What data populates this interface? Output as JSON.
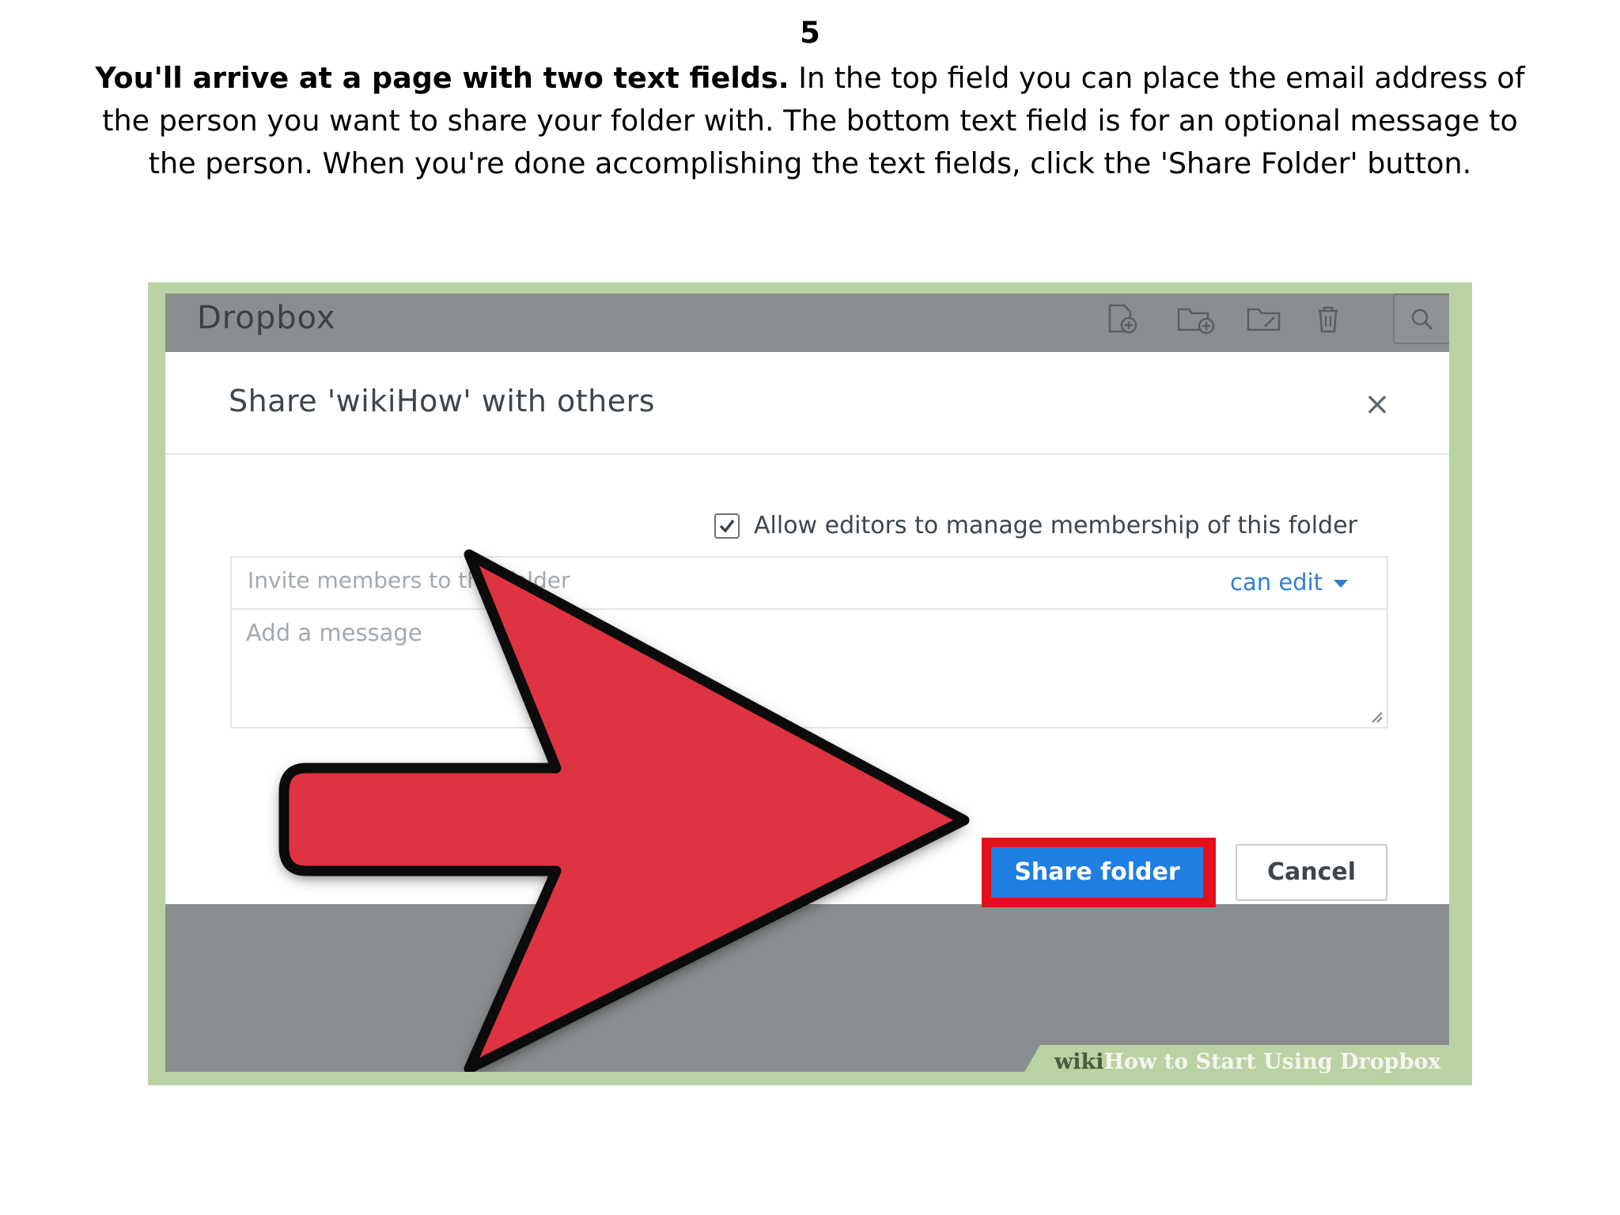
{
  "step": {
    "number": "5",
    "lead": "You'll arrive at a page with two text fields.",
    "body": " In the top field you can place the email address of the person you want to share your folder with. The bottom text field is for an optional message to the person. When you're done accomplishing the text fields, click the 'Share Folder' button."
  },
  "app": {
    "title": "Dropbox",
    "toolbar_icons": [
      "new-file-icon",
      "new-folder-icon",
      "shared-folder-icon",
      "trash-icon",
      "search-icon"
    ]
  },
  "dialog": {
    "title": "Share 'wikiHow' with others",
    "close_label": "×",
    "checkbox_checked": true,
    "checkbox_label": "Allow editors to manage membership of this folder",
    "invite_placeholder": "Invite members to this folder",
    "permission": "can edit",
    "message_placeholder": "Add a message",
    "share_label": "Share folder",
    "cancel_label": "Cancel"
  },
  "watermark": {
    "wiki": "wiki",
    "title": "How to Start Using Dropbox"
  },
  "colors": {
    "frame": "#b9d2a3",
    "app_background": "#8b8e90",
    "primary_button": "#1f7fe3",
    "highlight": "#e3101b",
    "arrow": "#de3340"
  }
}
